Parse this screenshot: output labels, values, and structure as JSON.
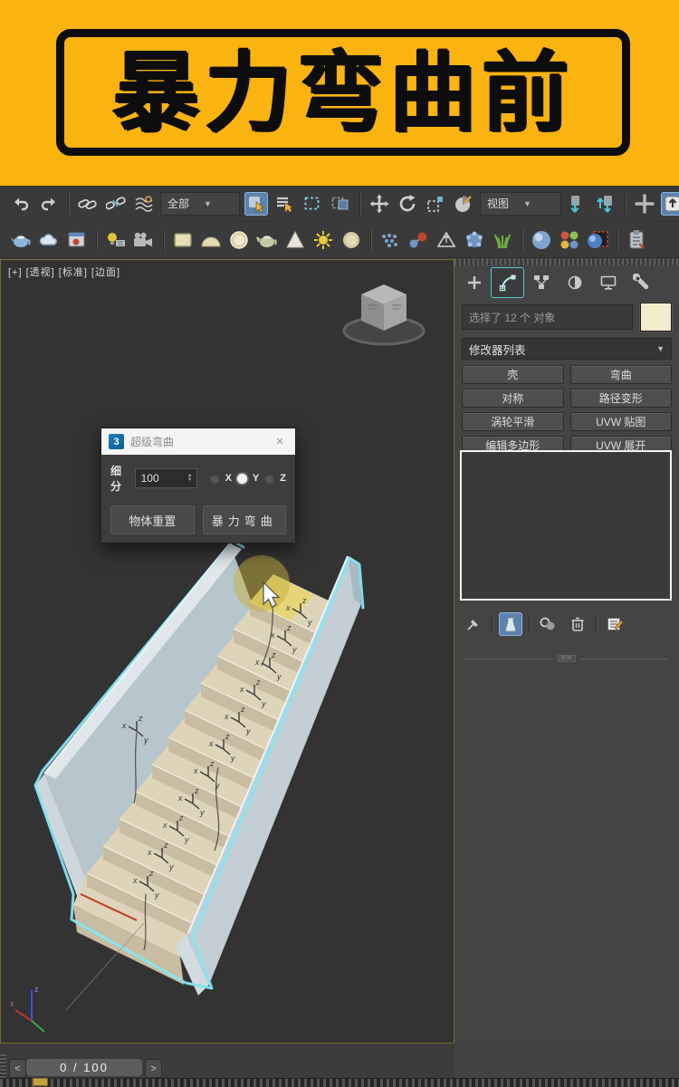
{
  "banner": {
    "title": "暴力弯曲前",
    "bg_color": "#fbb30f",
    "text_color": "#0d0d0d"
  },
  "toolbar": {
    "filter_value": "全部",
    "coord_value": "视图",
    "row1_icons": [
      "undo-icon",
      "redo-icon",
      "link-icon",
      "unlink-icon",
      "bind-spacewarp-icon",
      "filter-dropdown",
      "select-object-button",
      "select-by-name-icon",
      "rect-region-icon",
      "window-crossing-icon",
      "move-icon",
      "rotate-icon",
      "scale-icon",
      "pivot-center-icon",
      "coord-dropdown",
      "snap-toggle-icon",
      "snap-angle-icon",
      "manipulate-icon",
      "kbd-override-button",
      "light-bulb-icon"
    ],
    "row2_icons": [
      "render-teapot-icon",
      "cloud-icon",
      "render-setup-icon",
      "light-lister-icon",
      "camera-icon",
      "primitive-box-icon",
      "primitive-dome-icon",
      "primitive-sphere-icon",
      "primitive-teapot-icon",
      "primitive-cone-icon",
      "sun-icon",
      "sphere-tan-icon",
      "scatter-icon",
      "molecule-icon",
      "pyramid-icon",
      "flowerball-icon",
      "grass-icon",
      "sphere-blue-icon",
      "material-editor-icon",
      "sphere-select-icon",
      "clipboard-icon"
    ]
  },
  "viewport": {
    "label": "[+] [透视] [标准] [边面]"
  },
  "dialog": {
    "icon_glyph": "3",
    "title": "超级弯曲",
    "close_glyph": "×",
    "subdiv_label": "细分",
    "subdiv_value": "100",
    "axes": [
      "X",
      "Y",
      "Z"
    ],
    "selected_axis": "Y",
    "reset_button": "物体重置",
    "bend_button": "暴力弯曲"
  },
  "panel": {
    "selection_text": "选择了 12 个 对象",
    "modifier_list_label": "修改器列表",
    "modifier_buttons": [
      "壳",
      "弯曲",
      "对称",
      "路径变形",
      "涡轮平滑",
      "UVW 贴图",
      "编辑多边形",
      "UVW 展开"
    ],
    "separator_text": "WW",
    "tabs": [
      "create",
      "modify",
      "hierarchy",
      "motion",
      "display",
      "utilities"
    ],
    "active_tab": "modify",
    "swatch_color": "#f4ecca"
  },
  "timeline": {
    "prev": "<",
    "next": ">",
    "frame_display": "0 / 100"
  },
  "colors": {
    "selection_outline": "#84e6f4",
    "active_button": "#5c83ad",
    "viewport_border": "#786a33"
  }
}
